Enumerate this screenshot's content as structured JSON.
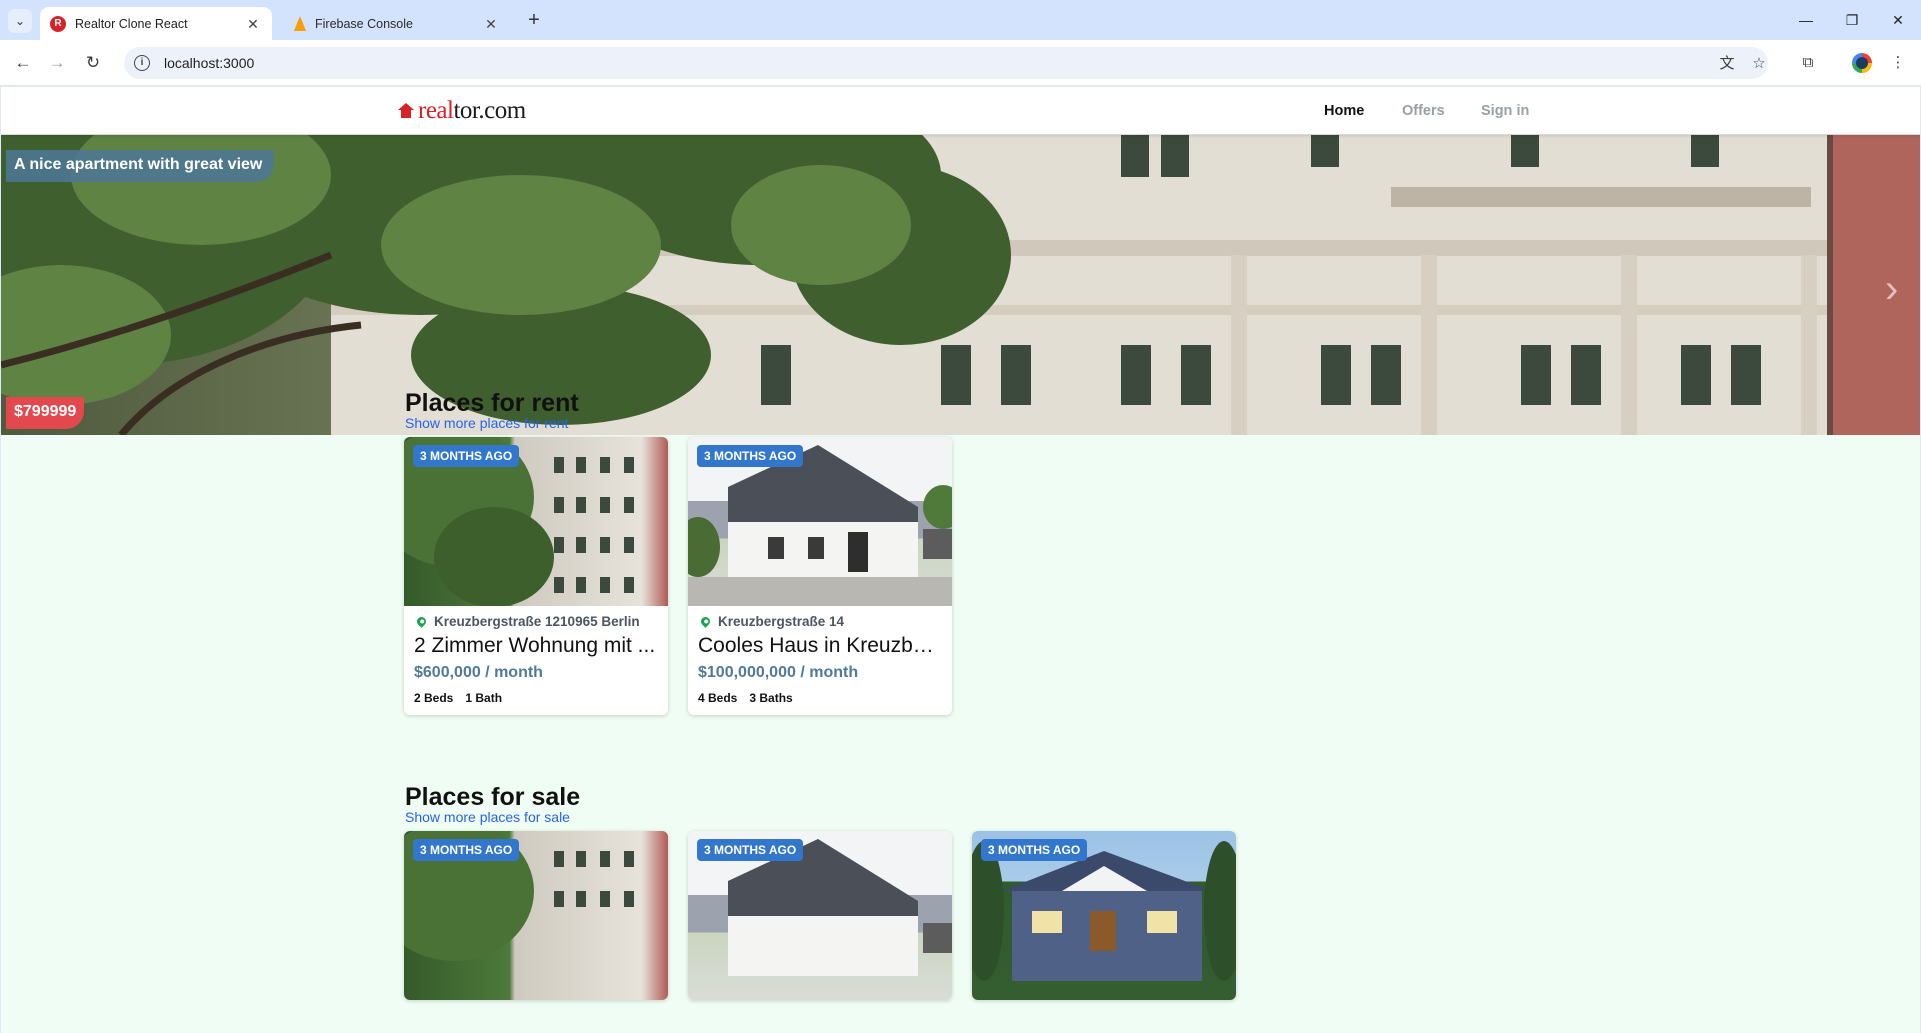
{
  "browser": {
    "tabs": [
      {
        "title": "Realtor Clone React",
        "active": true,
        "favicon": "realtor-favicon"
      },
      {
        "title": "Firebase Console",
        "active": false,
        "favicon": "firebase-favicon"
      }
    ],
    "url": "localhost:3000"
  },
  "site": {
    "logo_part1": "real",
    "logo_part2": "tor.com",
    "nav": {
      "home": "Home",
      "offers": "Offers",
      "signin": "Sign in"
    }
  },
  "hero": {
    "title": "A nice apartment with great view",
    "price": "$799999"
  },
  "rent": {
    "title": "Places for rent",
    "link": "Show more places for rent",
    "listings": [
      {
        "badge": "3 MONTHS AGO",
        "address": "Kreuzbergstraße 1210965 Berlin",
        "name": "2 Zimmer Wohnung mit ...",
        "price": "$600,000 / month",
        "beds": "2 Beds",
        "baths": "1 Bath",
        "image": "apartment-building"
      },
      {
        "badge": "3 MONTHS AGO",
        "address": "Kreuzbergstraße 14",
        "name": "Cooles Haus in Kreuzberg",
        "price": "$100,000,000 / month",
        "beds": "4 Beds",
        "baths": "3 Baths",
        "image": "white-house"
      }
    ]
  },
  "sale": {
    "title": "Places for sale",
    "link": "Show more places for sale",
    "listings": [
      {
        "badge": "3 MONTHS AGO",
        "image": "apartment-building"
      },
      {
        "badge": "3 MONTHS AGO",
        "image": "white-house"
      },
      {
        "badge": "3 MONTHS AGO",
        "image": "craftsman-house"
      }
    ]
  },
  "colors": {
    "brand_red": "#d92228",
    "page_bg": "#f0fdf4",
    "link_blue": "#2563eb",
    "badge_blue": "#3377cc",
    "price_blue": "#4f7a9a"
  }
}
